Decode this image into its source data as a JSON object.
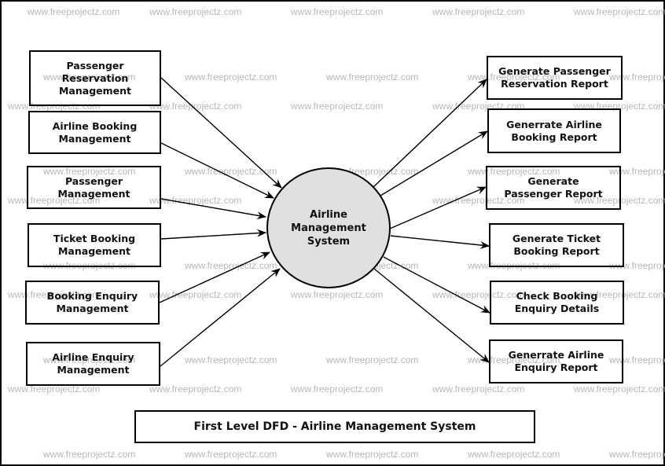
{
  "diagram": {
    "type": "Data Flow Diagram (Level 1)",
    "watermark": "www.freeprojectz.com",
    "center_process": {
      "label": "Airline\nManagement\nSystem",
      "fill": "#e0e0e0"
    },
    "inputs": [
      {
        "id": "in1",
        "label": "Passenger\nReservation\nManagement"
      },
      {
        "id": "in2",
        "label": "Airline Booking\nManagement"
      },
      {
        "id": "in3",
        "label": "Passenger\nManagement"
      },
      {
        "id": "in4",
        "label": "Ticket Booking\nManagement"
      },
      {
        "id": "in5",
        "label": "Booking Enquiry\nManagement"
      },
      {
        "id": "in6",
        "label": "Airline Enquiry\nManagement"
      }
    ],
    "outputs": [
      {
        "id": "out1",
        "label": "Generate Passenger\nReservation Report"
      },
      {
        "id": "out2",
        "label": "Generrate Airline\nBooking Report"
      },
      {
        "id": "out3",
        "label": "Generate\nPassenger Report"
      },
      {
        "id": "out4",
        "label": "Generate Ticket\nBooking Report"
      },
      {
        "id": "out5",
        "label": "Check Booking\nEnquiry Details"
      },
      {
        "id": "out6",
        "label": "Generrate Airline\nEnquiry Report"
      }
    ],
    "flows": [
      {
        "from": "in1",
        "to": "center"
      },
      {
        "from": "in2",
        "to": "center"
      },
      {
        "from": "in3",
        "to": "center"
      },
      {
        "from": "in4",
        "to": "center"
      },
      {
        "from": "in5",
        "to": "center"
      },
      {
        "from": "in6",
        "to": "center"
      },
      {
        "from": "center",
        "to": "out1"
      },
      {
        "from": "center",
        "to": "out2"
      },
      {
        "from": "center",
        "to": "out3"
      },
      {
        "from": "center",
        "to": "out4"
      },
      {
        "from": "center",
        "to": "out5"
      },
      {
        "from": "center",
        "to": "out6"
      }
    ],
    "caption": "First Level DFD - Airline Management System"
  }
}
